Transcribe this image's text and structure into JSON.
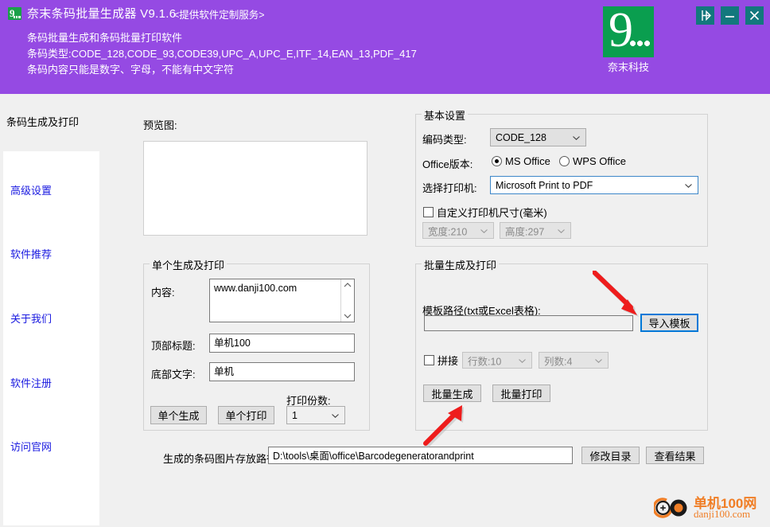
{
  "header": {
    "title": "奈末条码批量生成器 V9.1.6",
    "subtitle": "<提供软件定制服务>",
    "desc_line1": "条码批量生成和条码批量打印软件",
    "desc_line2": "条码类型:CODE_128,CODE_93,CODE39,UPC_A,UPC_E,ITF_14,EAN_13,PDF_417",
    "desc_line3": "条码内容只能是数字、字母，不能有中文字符",
    "brand_name": "奈末科技",
    "brand_mark": "9",
    "bg_color": "#954ae3",
    "brand_color": "#0a9e4f",
    "window_buttons": [
      {
        "name": "pin-on-top",
        "label": ""
      },
      {
        "name": "minimize",
        "label": ""
      },
      {
        "name": "close",
        "label": ""
      }
    ]
  },
  "sidebar": {
    "title": "条码生成及打印",
    "items": [
      {
        "label": "高级设置"
      },
      {
        "label": "软件推荐"
      },
      {
        "label": "关于我们"
      },
      {
        "label": "软件注册"
      },
      {
        "label": "访问官网"
      }
    ],
    "link_color": "#1a1ae0"
  },
  "preview": {
    "label": "预览图:",
    "content": ""
  },
  "basic_settings": {
    "legend": "基本设置",
    "encode_type_label": "编码类型:",
    "encode_type_value": "CODE_128",
    "office_label": "Office版本:",
    "office_options": [
      {
        "label": "MS Office",
        "selected": true
      },
      {
        "label": "WPS Office",
        "selected": false
      }
    ],
    "printer_label": "选择打印机:",
    "printer_value": "Microsoft Print to PDF",
    "custom_size_label": "自定义打印机尺寸(毫米)",
    "custom_size_checked": false,
    "width_value": "宽度:210",
    "height_value": "高度:297"
  },
  "single_panel": {
    "legend": "单个生成及打印",
    "content_label": "内容:",
    "content_value": "www.danji100.com",
    "top_title_label": "顶部标题:",
    "top_title_value": "单机100",
    "bottom_text_label": "底部文字:",
    "bottom_text_value": "单机",
    "copies_label": "打印份数:",
    "copies_value": "1",
    "generate_button": "单个生成",
    "print_button": "单个打印"
  },
  "batch_panel": {
    "legend": "批量生成及打印",
    "template_path_label": "模板路径(txt或Excel表格):",
    "template_path_value": "",
    "import_button": "导入模板",
    "merge_label": "拼接",
    "merge_checked": false,
    "rows_value": "行数:10",
    "cols_value": "列数:4",
    "batch_generate_button": "批量生成",
    "batch_print_button": "批量打印"
  },
  "bottom_bar": {
    "save_path_label": "生成的条码图片存放路径:",
    "save_path_value": "D:\\tools\\桌面\\office\\Barcodegeneratorandprint",
    "change_dir_button": "修改目录",
    "view_result_button": "查看结果"
  },
  "watermark": {
    "line1": "单机100网",
    "line2": "danji100.com",
    "color": "#f07e26"
  },
  "annotations": {
    "arrow1_target": "导入模板",
    "arrow2_target": "批量生成",
    "arrow_color": "#ee1c1c"
  }
}
